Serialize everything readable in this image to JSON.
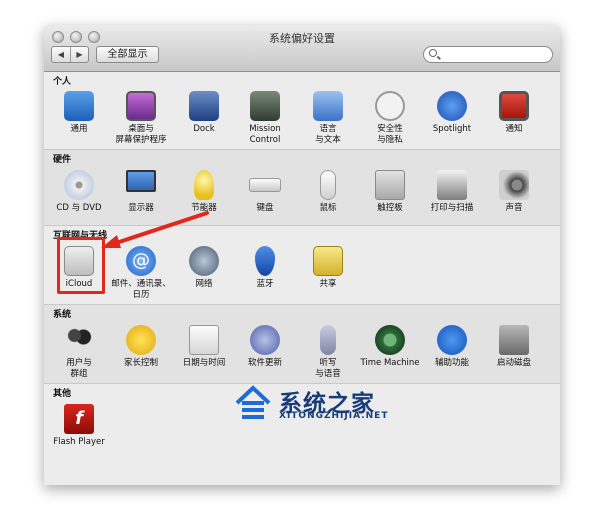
{
  "window": {
    "title": "系统偏好设置",
    "show_all_label": "全部显示",
    "back_glyph": "◀",
    "forward_glyph": "▶",
    "search_placeholder": ""
  },
  "sections": {
    "personal": {
      "label": "个人",
      "items": [
        {
          "label": "通用",
          "icon": "general-icon"
        },
        {
          "label": "桌面与\n屏幕保护程序",
          "icon": "desktop-screensaver-icon"
        },
        {
          "label": "Dock",
          "icon": "dock-icon"
        },
        {
          "label": "Mission\nControl",
          "icon": "mission-control-icon"
        },
        {
          "label": "语言\n与文本",
          "icon": "language-text-icon"
        },
        {
          "label": "安全性\n与隐私",
          "icon": "security-privacy-icon"
        },
        {
          "label": "Spotlight",
          "icon": "spotlight-icon"
        },
        {
          "label": "通知",
          "icon": "notifications-icon"
        }
      ]
    },
    "hardware": {
      "label": "硬件",
      "items": [
        {
          "label": "CD 与 DVD",
          "icon": "cd-dvd-icon"
        },
        {
          "label": "显示器",
          "icon": "displays-icon"
        },
        {
          "label": "节能器",
          "icon": "energy-saver-icon"
        },
        {
          "label": "键盘",
          "icon": "keyboard-icon"
        },
        {
          "label": "鼠标",
          "icon": "mouse-icon"
        },
        {
          "label": "触控板",
          "icon": "trackpad-icon"
        },
        {
          "label": "打印与扫描",
          "icon": "print-scan-icon"
        },
        {
          "label": "声音",
          "icon": "sound-icon"
        }
      ]
    },
    "internet": {
      "label": "互联网与无线",
      "items": [
        {
          "label": "iCloud",
          "icon": "icloud-icon"
        },
        {
          "label": "邮件、通讯录、\n日历",
          "icon": "mail-contacts-icon"
        },
        {
          "label": "网络",
          "icon": "network-icon"
        },
        {
          "label": "蓝牙",
          "icon": "bluetooth-icon"
        },
        {
          "label": "共享",
          "icon": "sharing-icon"
        }
      ]
    },
    "system": {
      "label": "系统",
      "items": [
        {
          "label": "用户与\n群组",
          "icon": "users-groups-icon"
        },
        {
          "label": "家长控制",
          "icon": "parental-controls-icon"
        },
        {
          "label": "日期与时间",
          "icon": "date-time-icon"
        },
        {
          "label": "软件更新",
          "icon": "software-update-icon"
        },
        {
          "label": "听写\n与语音",
          "icon": "dictation-speech-icon"
        },
        {
          "label": "Time Machine",
          "icon": "time-machine-icon"
        },
        {
          "label": "辅助功能",
          "icon": "accessibility-icon"
        },
        {
          "label": "启动磁盘",
          "icon": "startup-disk-icon"
        }
      ]
    },
    "other": {
      "label": "其他",
      "items": [
        {
          "label": "Flash Player",
          "icon": "flash-player-icon"
        }
      ]
    }
  },
  "watermark": {
    "title": "系统之家",
    "url": "XITONGZHIJIA.NET"
  },
  "colors": {
    "highlight": "#e1281c",
    "watermark": "#183c7a"
  }
}
